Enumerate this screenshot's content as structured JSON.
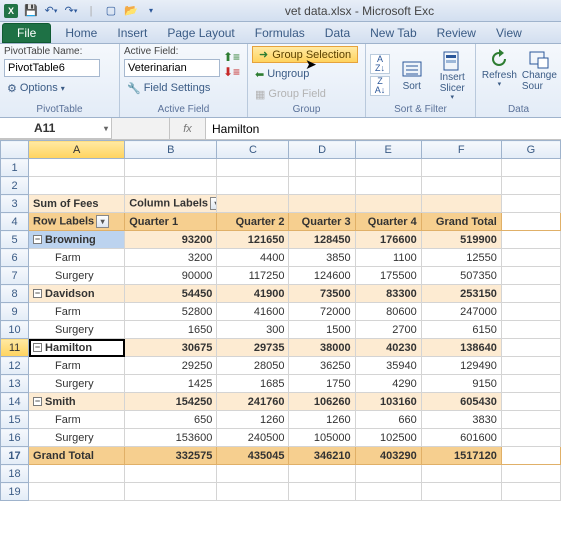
{
  "title": "vet data.xlsx - Microsoft Exc",
  "tabs": {
    "file": "File",
    "home": "Home",
    "insert": "Insert",
    "pageLayout": "Page Layout",
    "formulas": "Formulas",
    "data": "Data",
    "newTab": "New Tab",
    "review": "Review",
    "view": "View"
  },
  "ribbon": {
    "pivotTable": {
      "groupLabel": "PivotTable",
      "nameLabel": "PivotTable Name:",
      "nameValue": "PivotTable6",
      "options": "Options"
    },
    "activeField": {
      "groupLabel": "Active Field",
      "label": "Active Field:",
      "value": "Veterinarian",
      "fieldSettings": "Field Settings"
    },
    "group": {
      "groupLabel": "Group",
      "groupSelection": "Group Selection",
      "ungroup": "Ungroup",
      "groupField": "Group Field"
    },
    "sortFilter": {
      "groupLabel": "Sort & Filter",
      "sort": "Sort",
      "insertSlicer": "Insert\nSlicer"
    },
    "data": {
      "groupLabel": "Data",
      "refresh": "Refresh",
      "changeSource": "Change\nSour"
    }
  },
  "nameBox": "A11",
  "formula": "Hamilton",
  "cols": [
    "A",
    "B",
    "C",
    "D",
    "E",
    "F",
    "G"
  ],
  "pivot": {
    "sumOfFees": "Sum of Fees",
    "columnLabels": "Column Labels",
    "rowLabels": "Row Labels",
    "headers": [
      "Quarter 1",
      "Quarter 2",
      "Quarter 3",
      "Quarter 4",
      "Grand Total"
    ],
    "rows": [
      {
        "name": "Browning",
        "type": "group",
        "vals": [
          "93200",
          "121650",
          "128450",
          "176600",
          "519900"
        ]
      },
      {
        "name": "Farm",
        "type": "child",
        "vals": [
          "3200",
          "4400",
          "3850",
          "1100",
          "12550"
        ]
      },
      {
        "name": "Surgery",
        "type": "child",
        "vals": [
          "90000",
          "117250",
          "124600",
          "175500",
          "507350"
        ]
      },
      {
        "name": "Davidson",
        "type": "group",
        "vals": [
          "54450",
          "41900",
          "73500",
          "83300",
          "253150"
        ]
      },
      {
        "name": "Farm",
        "type": "child",
        "vals": [
          "52800",
          "41600",
          "72000",
          "80600",
          "247000"
        ]
      },
      {
        "name": "Surgery",
        "type": "child",
        "vals": [
          "1650",
          "300",
          "1500",
          "2700",
          "6150"
        ]
      },
      {
        "name": "Hamilton",
        "type": "group",
        "vals": [
          "30675",
          "29735",
          "38000",
          "40230",
          "138640"
        ]
      },
      {
        "name": "Farm",
        "type": "child",
        "vals": [
          "29250",
          "28050",
          "36250",
          "35940",
          "129490"
        ]
      },
      {
        "name": "Surgery",
        "type": "child",
        "vals": [
          "1425",
          "1685",
          "1750",
          "4290",
          "9150"
        ]
      },
      {
        "name": "Smith",
        "type": "group",
        "vals": [
          "154250",
          "241760",
          "106260",
          "103160",
          "605430"
        ]
      },
      {
        "name": "Farm",
        "type": "child",
        "vals": [
          "650",
          "1260",
          "1260",
          "660",
          "3830"
        ]
      },
      {
        "name": "Surgery",
        "type": "child",
        "vals": [
          "153600",
          "240500",
          "105000",
          "102500",
          "601600"
        ]
      }
    ],
    "grandTotal": {
      "label": "Grand Total",
      "vals": [
        "332575",
        "435045",
        "346210",
        "403290",
        "1517120"
      ]
    }
  }
}
